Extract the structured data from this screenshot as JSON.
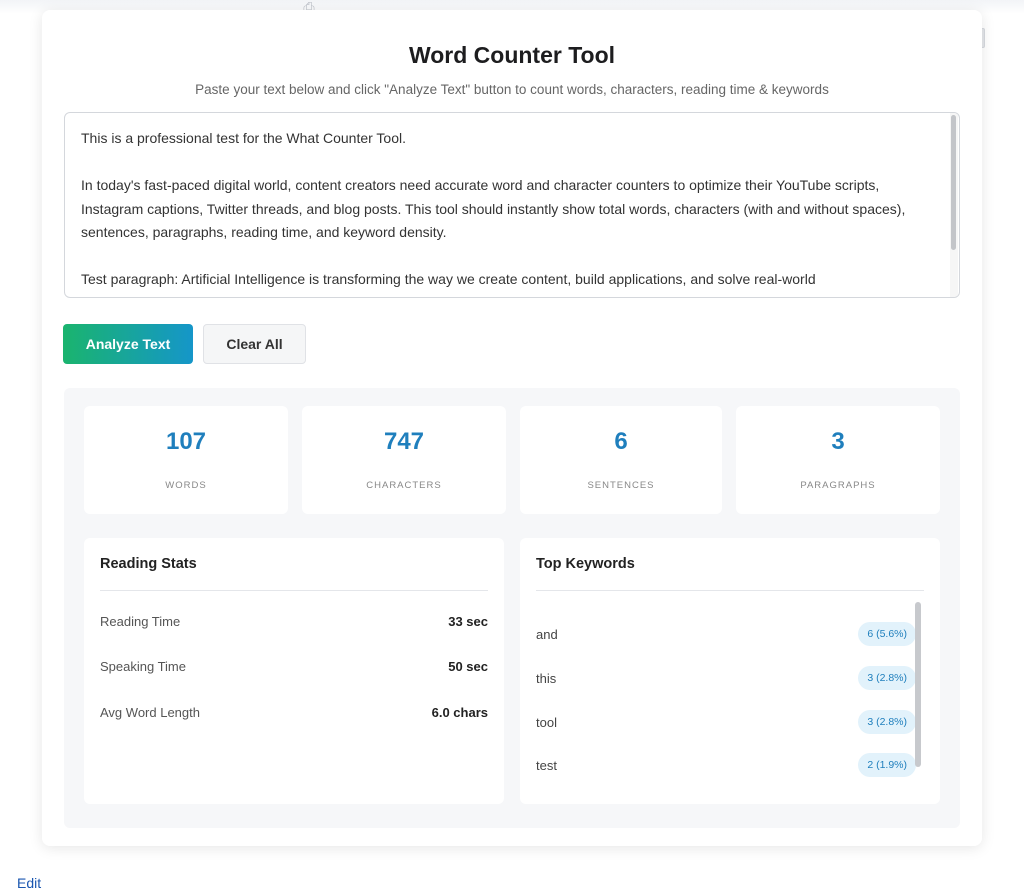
{
  "header": {
    "title": "Word Counter Tool",
    "subtitle": "Paste your text below and click \"Analyze Text\" button to count words, characters, reading time & keywords"
  },
  "input": {
    "paragraphs": [
      "This is a professional test for the What Counter Tool.",
      "In today's fast-paced digital world, content creators need accurate word and character counters to optimize their YouTube scripts, Instagram captions, Twitter threads, and blog posts. This tool should instantly show total words, characters (with and without spaces), sentences, paragraphs, reading time, and keyword density.",
      "Test paragraph: Artificial Intelligence is transforming the way we create content, build applications, and solve real-world"
    ]
  },
  "buttons": {
    "analyze": "Analyze Text",
    "clear": "Clear All"
  },
  "stats": [
    {
      "value": "107",
      "label": "WORDS"
    },
    {
      "value": "747",
      "label": "CHARACTERS"
    },
    {
      "value": "6",
      "label": "SENTENCES"
    },
    {
      "value": "3",
      "label": "PARAGRAPHS"
    }
  ],
  "reading_stats": {
    "title": "Reading Stats",
    "rows": [
      {
        "label": "Reading Time",
        "value": "33 sec"
      },
      {
        "label": "Speaking Time",
        "value": "50 sec"
      },
      {
        "label": "Avg Word Length",
        "value": "6.0 chars"
      }
    ]
  },
  "keywords": {
    "title": "Top Keywords",
    "items": [
      {
        "word": "and",
        "count": "6 (5.6%)"
      },
      {
        "word": "this",
        "count": "3 (2.8%)"
      },
      {
        "word": "tool",
        "count": "3 (2.8%)"
      },
      {
        "word": "test",
        "count": "2 (1.9%)"
      }
    ]
  },
  "footer": {
    "edit_label": "Edit"
  },
  "colors": {
    "accent_blue": "#1f7fbd",
    "gradient_start": "#1ab46e",
    "gradient_end": "#1596c9"
  }
}
